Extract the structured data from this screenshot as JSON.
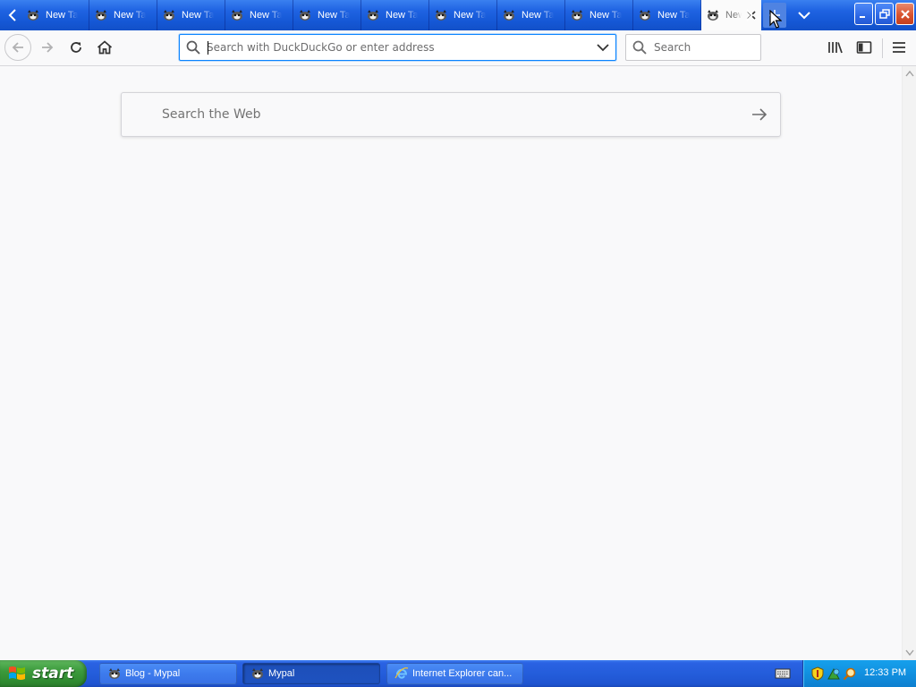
{
  "tabs": {
    "items": [
      {
        "label": "New Tab",
        "selected": false
      },
      {
        "label": "New Tab",
        "selected": false
      },
      {
        "label": "New Tab",
        "selected": false
      },
      {
        "label": "New Tab",
        "selected": false
      },
      {
        "label": "New Tab",
        "selected": false
      },
      {
        "label": "New Tab",
        "selected": false
      },
      {
        "label": "New Tab",
        "selected": false
      },
      {
        "label": "New Tab",
        "selected": false
      },
      {
        "label": "New Tab",
        "selected": false
      },
      {
        "label": "New Tab",
        "selected": false
      },
      {
        "label": "New Tab",
        "selected": true
      }
    ],
    "favicon": "mypal-raccoon-icon",
    "new_tab_icon": "plus-icon",
    "all_tabs_icon": "chevron-down-icon"
  },
  "window_controls": {
    "minimize_icon": "minimize-icon",
    "maximize_icon": "restore-icon",
    "close_icon": "close-icon"
  },
  "toolbar": {
    "back_icon": "arrow-left-icon",
    "forward_icon": "arrow-right-icon",
    "reload_icon": "reload-icon",
    "home_icon": "home-icon",
    "url_placeholder": "Search with DuckDuckGo or enter address",
    "url_value": "",
    "search_placeholder": "Search",
    "library_icon": "library-icon",
    "sidebar_icon": "sidebar-icon",
    "menu_icon": "hamburger-menu-icon"
  },
  "content": {
    "web_search_placeholder": "Search the Web",
    "web_search_go_icon": "arrow-right-icon"
  },
  "taskbar": {
    "start_label": "start",
    "tasks": [
      {
        "label": "Blog - Mypal",
        "icon": "mypal-raccoon-icon",
        "active": false
      },
      {
        "label": "Mypal",
        "icon": "mypal-raccoon-icon",
        "active": true
      },
      {
        "label": "Internet Explorer can...",
        "icon": "internet-explorer-icon",
        "active": false
      }
    ],
    "tray_icons": [
      "security-shield-icon",
      "network-icon",
      "search-magnifier-icon"
    ],
    "clock": "12:33 PM"
  },
  "colors": {
    "accent_focus": "#0a84ff",
    "titlebar_blue": "#1f5fe0",
    "taskbar_blue": "#245ddb",
    "start_green": "#3c9a3c",
    "close_red": "#d9532f"
  }
}
